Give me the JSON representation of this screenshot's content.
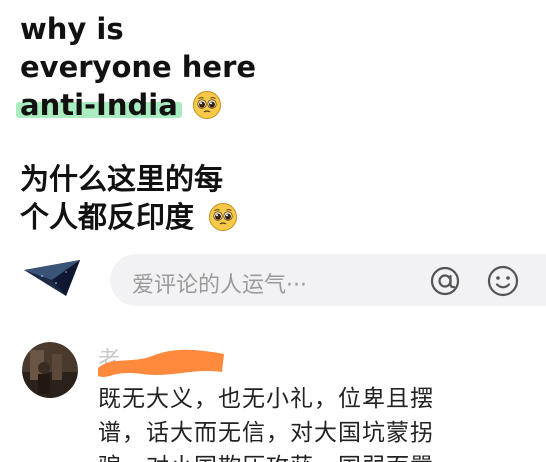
{
  "post": {
    "en_line1": "why is",
    "en_line2": "everyone here",
    "en_highlight": "anti-India",
    "cn_line1": "为什么这里的每",
    "cn_line2": "个人都反印度",
    "emoji": "pleading-face"
  },
  "comment_bar": {
    "placeholder": "爱评论的人运气···",
    "mention_icon": "at-icon",
    "emoji_icon": "smile-icon"
  },
  "comment": {
    "author_visible": "老",
    "body_line1": "既无大义，也无小礼，位卑且摆",
    "body_line2": "谱，话大而无信，对大国坑蒙拐",
    "body_line3": "骗，对小国欺压攻获，国弱而嚣"
  },
  "colors": {
    "highlight": "#a9ecc0",
    "redaction": "#ff8a3d",
    "input_bg": "#f2f2f4"
  }
}
